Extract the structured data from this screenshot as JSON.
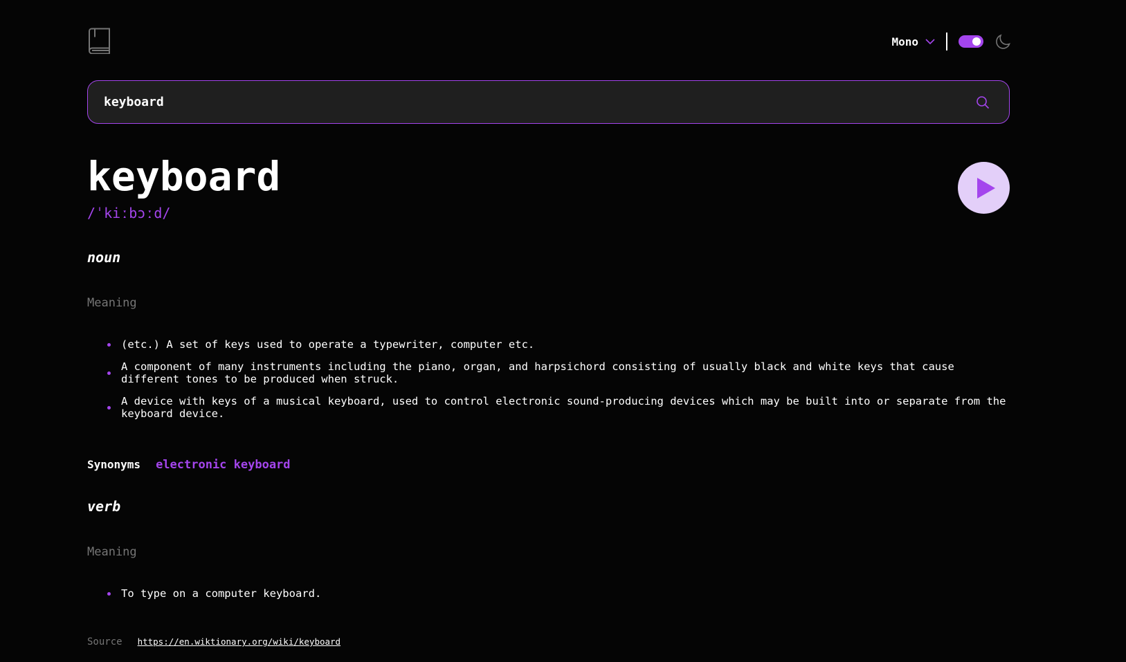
{
  "header": {
    "font_selected": "Mono",
    "theme_dark_enabled": true,
    "colors": {
      "accent": "#a445ed",
      "background": "#050505",
      "field": "#1f1f1f",
      "muted": "#757575"
    }
  },
  "search": {
    "value": "keyboard",
    "placeholder": ""
  },
  "entry": {
    "word": "keyboard",
    "phonetic": "/ˈkiːbɔːd/",
    "meanings": [
      {
        "part_of_speech": "noun",
        "label": "Meaning",
        "definitions": [
          "(etc.) A set of keys used to operate a typewriter, computer etc.",
          "A component of many instruments including the piano, organ, and harpsichord consisting of usually black and white keys that cause different tones to be produced when struck.",
          "A device with keys of a musical keyboard, used to control electronic sound-producing devices which may be built into or separate from the keyboard device."
        ],
        "synonyms_label": "Synonyms",
        "synonyms": [
          "electronic keyboard"
        ]
      },
      {
        "part_of_speech": "verb",
        "label": "Meaning",
        "definitions": [
          "To type on a computer keyboard."
        ]
      }
    ]
  },
  "footer": {
    "source_label": "Source",
    "source_url": "https://en.wiktionary.org/wiki/keyboard"
  }
}
